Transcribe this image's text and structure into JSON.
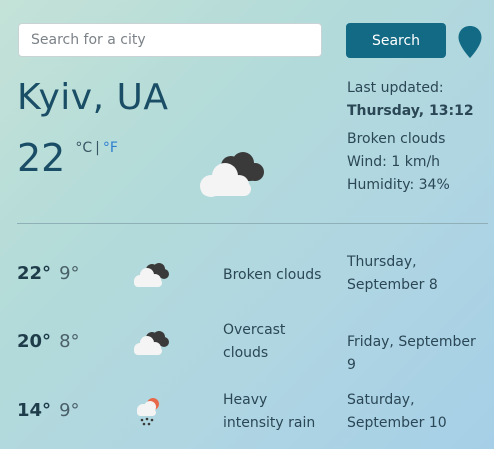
{
  "search": {
    "placeholder": "Search for a city",
    "button_label": "Search"
  },
  "current": {
    "city": "Kyiv, UA",
    "temperature": "22",
    "unit_c": "°C",
    "unit_separator": "|",
    "unit_f": "°F",
    "icon": "broken-clouds-icon",
    "last_updated_label": "Last updated:",
    "last_updated_value": "Thursday, 13:12",
    "condition": "Broken clouds",
    "wind": "Wind: 1 km/h",
    "humidity": "Humidity: 34%"
  },
  "forecast": [
    {
      "max": "22°",
      "min": "9°",
      "icon": "broken-clouds-icon",
      "condition_line1": "Broken clouds",
      "condition_line2": "",
      "date_line1": "Thursday,",
      "date_line2": "September 8"
    },
    {
      "max": "20°",
      "min": "8°",
      "icon": "overcast-clouds-icon",
      "condition_line1": "Overcast",
      "condition_line2": "clouds",
      "date_line1": "Friday, September 9",
      "date_line2": ""
    },
    {
      "max": "14°",
      "min": "9°",
      "icon": "heavy-rain-icon",
      "condition_line1": "Heavy",
      "condition_line2": "intensity rain",
      "date_line1": "Saturday,",
      "date_line2": "September 10"
    }
  ],
  "colors": {
    "accent": "#136a85",
    "city_text": "#1a4e66",
    "fahrenheit_link": "#2f7fd0"
  }
}
